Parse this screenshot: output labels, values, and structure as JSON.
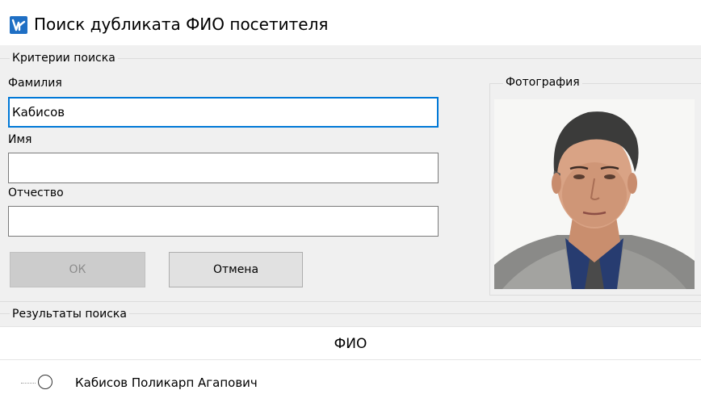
{
  "window": {
    "title": "Поиск дубликата ФИО посетителя",
    "icon": "app-logo-icon"
  },
  "criteria": {
    "legend": "Критерии поиска",
    "surname_label": "Фамилия",
    "surname_value": "Кабисов",
    "name_label": "Имя",
    "name_value": "",
    "patronymic_label": "Отчество",
    "patronymic_value": ""
  },
  "photo": {
    "legend": "Фотография"
  },
  "buttons": {
    "ok": "ОК",
    "cancel": "Отмена"
  },
  "results": {
    "legend": "Результаты поиска",
    "column_header": "ФИО",
    "rows": [
      {
        "label": "Кабисов Поликарп Агапович",
        "selected": false
      }
    ]
  }
}
